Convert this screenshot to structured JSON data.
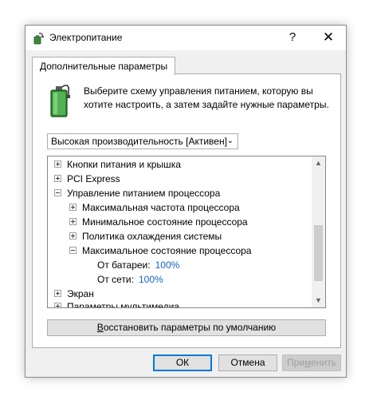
{
  "window": {
    "title": "Электропитание",
    "help_label": "?",
    "close_label": "✕"
  },
  "tab": {
    "label": "Дополнительные параметры"
  },
  "intro": {
    "line1": "Выберите схему управления питанием, которую вы",
    "line2": "хотите настроить, а затем задайте нужные параметры."
  },
  "scheme": {
    "selected": "Высокая производительность [Активен]"
  },
  "tree": {
    "items": [
      {
        "label": "Кнопки питания и крышка",
        "expanded": false
      },
      {
        "label": "PCI Express",
        "expanded": false
      },
      {
        "label": "Управление питанием процессора",
        "expanded": true
      },
      {
        "label": "Максимальная частота процессора",
        "expanded": false
      },
      {
        "label": "Минимальное состояние процессора",
        "expanded": false
      },
      {
        "label": "Политика охлаждения системы",
        "expanded": false
      },
      {
        "label": "Максимальное состояние процессора",
        "expanded": true
      },
      {
        "label": "От батареи:",
        "value": "100%"
      },
      {
        "label": "От сети:",
        "value": "100%"
      },
      {
        "label": "Экран",
        "expanded": false
      },
      {
        "label": "Параметры мультимедиа",
        "expanded": false
      }
    ]
  },
  "buttons": {
    "restore_underlined": "В",
    "restore_rest": "осстановить параметры по умолчанию",
    "ok": "ОК",
    "cancel": "Отмена",
    "apply_pre": "При",
    "apply_underlined": "м",
    "apply_post": "енить"
  },
  "colors": {
    "value_link": "#1463c8",
    "ok_border": "#0078d7"
  }
}
